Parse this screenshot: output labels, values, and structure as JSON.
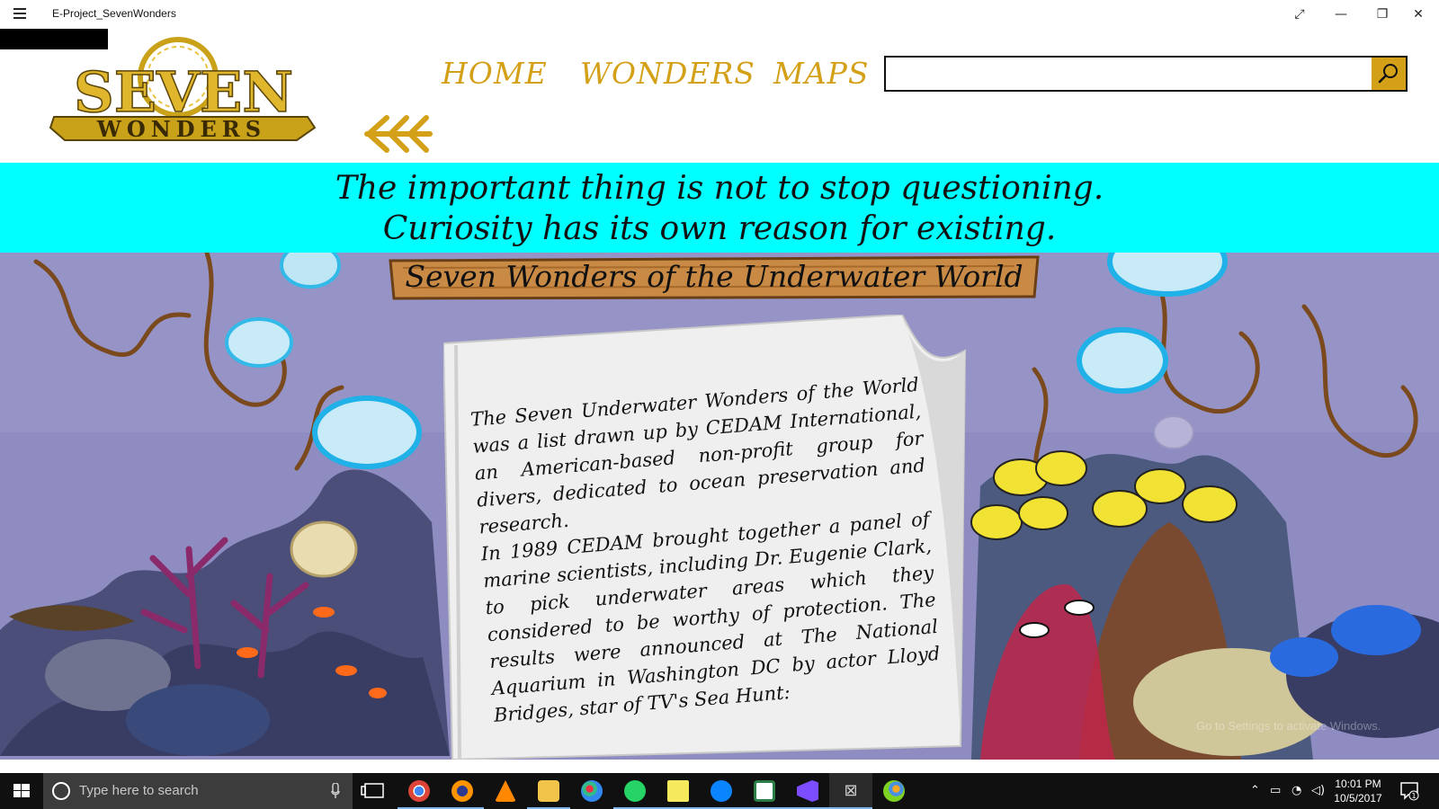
{
  "window": {
    "title": "E-Project_SevenWonders",
    "controls": [
      "⤢",
      "—",
      "❐",
      "✕"
    ]
  },
  "logo": {
    "line1": "SEVEN",
    "line2": "WONDERS"
  },
  "nav": {
    "home": "HOME",
    "wonders": "WONDERS",
    "maps": "MAPS"
  },
  "search": {
    "value": "",
    "placeholder": ""
  },
  "quote": "The important thing is not to stop questioning. Curiosity has its own reason for existing.",
  "main": {
    "plank_title": "Seven Wonders of the Underwater World",
    "paragraph1": "The Seven Underwater Wonders of the World was a list drawn up by CEDAM International, an American-based non-profit group for divers, dedicated to ocean preservation and research.",
    "paragraph2": "In 1989 CEDAM brought together a panel of marine scientists, including Dr. Eugenie Clark, to pick underwater areas which they considered to be worthy of protection. The results were announced at The National Aquarium in Washington DC by actor Lloyd Bridges, star of TV's Sea Hunt:"
  },
  "watermark": "Go to Settings to activate Windows.",
  "taskbar": {
    "search_placeholder": "Type here to search",
    "time": "10:01 PM",
    "date": "10/5/2017",
    "notification_count": "1",
    "apps": [
      "chrome-icon",
      "firefox-icon",
      "vlc-icon",
      "file-explorer-icon",
      "paint-icon",
      "whatsapp-icon",
      "sticky-notes-icon",
      "skype-icon",
      "app-window-icon",
      "visual-studio-icon",
      "seven-wonders-app-icon",
      "paint3d-icon"
    ]
  },
  "colors": {
    "gold": "#d4a017",
    "cyan_banner": "#00ffff",
    "ocean": "#8c8bbf",
    "taskbar": "#101010"
  }
}
